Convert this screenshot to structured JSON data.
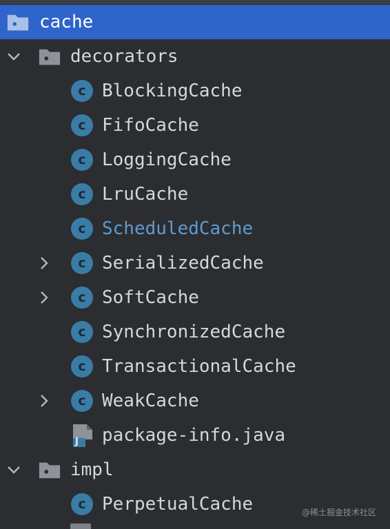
{
  "tree": {
    "root": {
      "label": "cache",
      "icon": "folder-icon"
    },
    "decorators": {
      "label": "decorators",
      "icon": "folder-icon",
      "expanded": true
    },
    "decorator_items": [
      {
        "label": "BlockingCache",
        "icon_letter": "c",
        "expandable": false
      },
      {
        "label": "FifoCache",
        "icon_letter": "c",
        "expandable": false
      },
      {
        "label": "LoggingCache",
        "icon_letter": "c",
        "expandable": false
      },
      {
        "label": "LruCache",
        "icon_letter": "c",
        "expandable": false
      },
      {
        "label": "ScheduledCache",
        "icon_letter": "c",
        "expandable": false,
        "modified": true
      },
      {
        "label": "SerializedCache",
        "icon_letter": "c",
        "expandable": true
      },
      {
        "label": "SoftCache",
        "icon_letter": "c",
        "expandable": true
      },
      {
        "label": "SynchronizedCache",
        "icon_letter": "c",
        "expandable": false
      },
      {
        "label": "TransactionalCache",
        "icon_letter": "c",
        "expandable": false
      },
      {
        "label": "WeakCache",
        "icon_letter": "c",
        "expandable": true
      }
    ],
    "package_info": {
      "label": "package-info.java",
      "icon_letter": "J"
    },
    "impl": {
      "label": "impl",
      "icon": "folder-icon",
      "expanded": true
    },
    "impl_items": [
      {
        "label": "PerpetualCache",
        "icon_letter": "c"
      }
    ]
  },
  "watermark": "@稀土掘金技术社区",
  "colors": {
    "selection": "#2f65ca",
    "background": "#2b2d30",
    "class_icon": "#3a7ca8",
    "modified_text": "#5f9bcf"
  }
}
